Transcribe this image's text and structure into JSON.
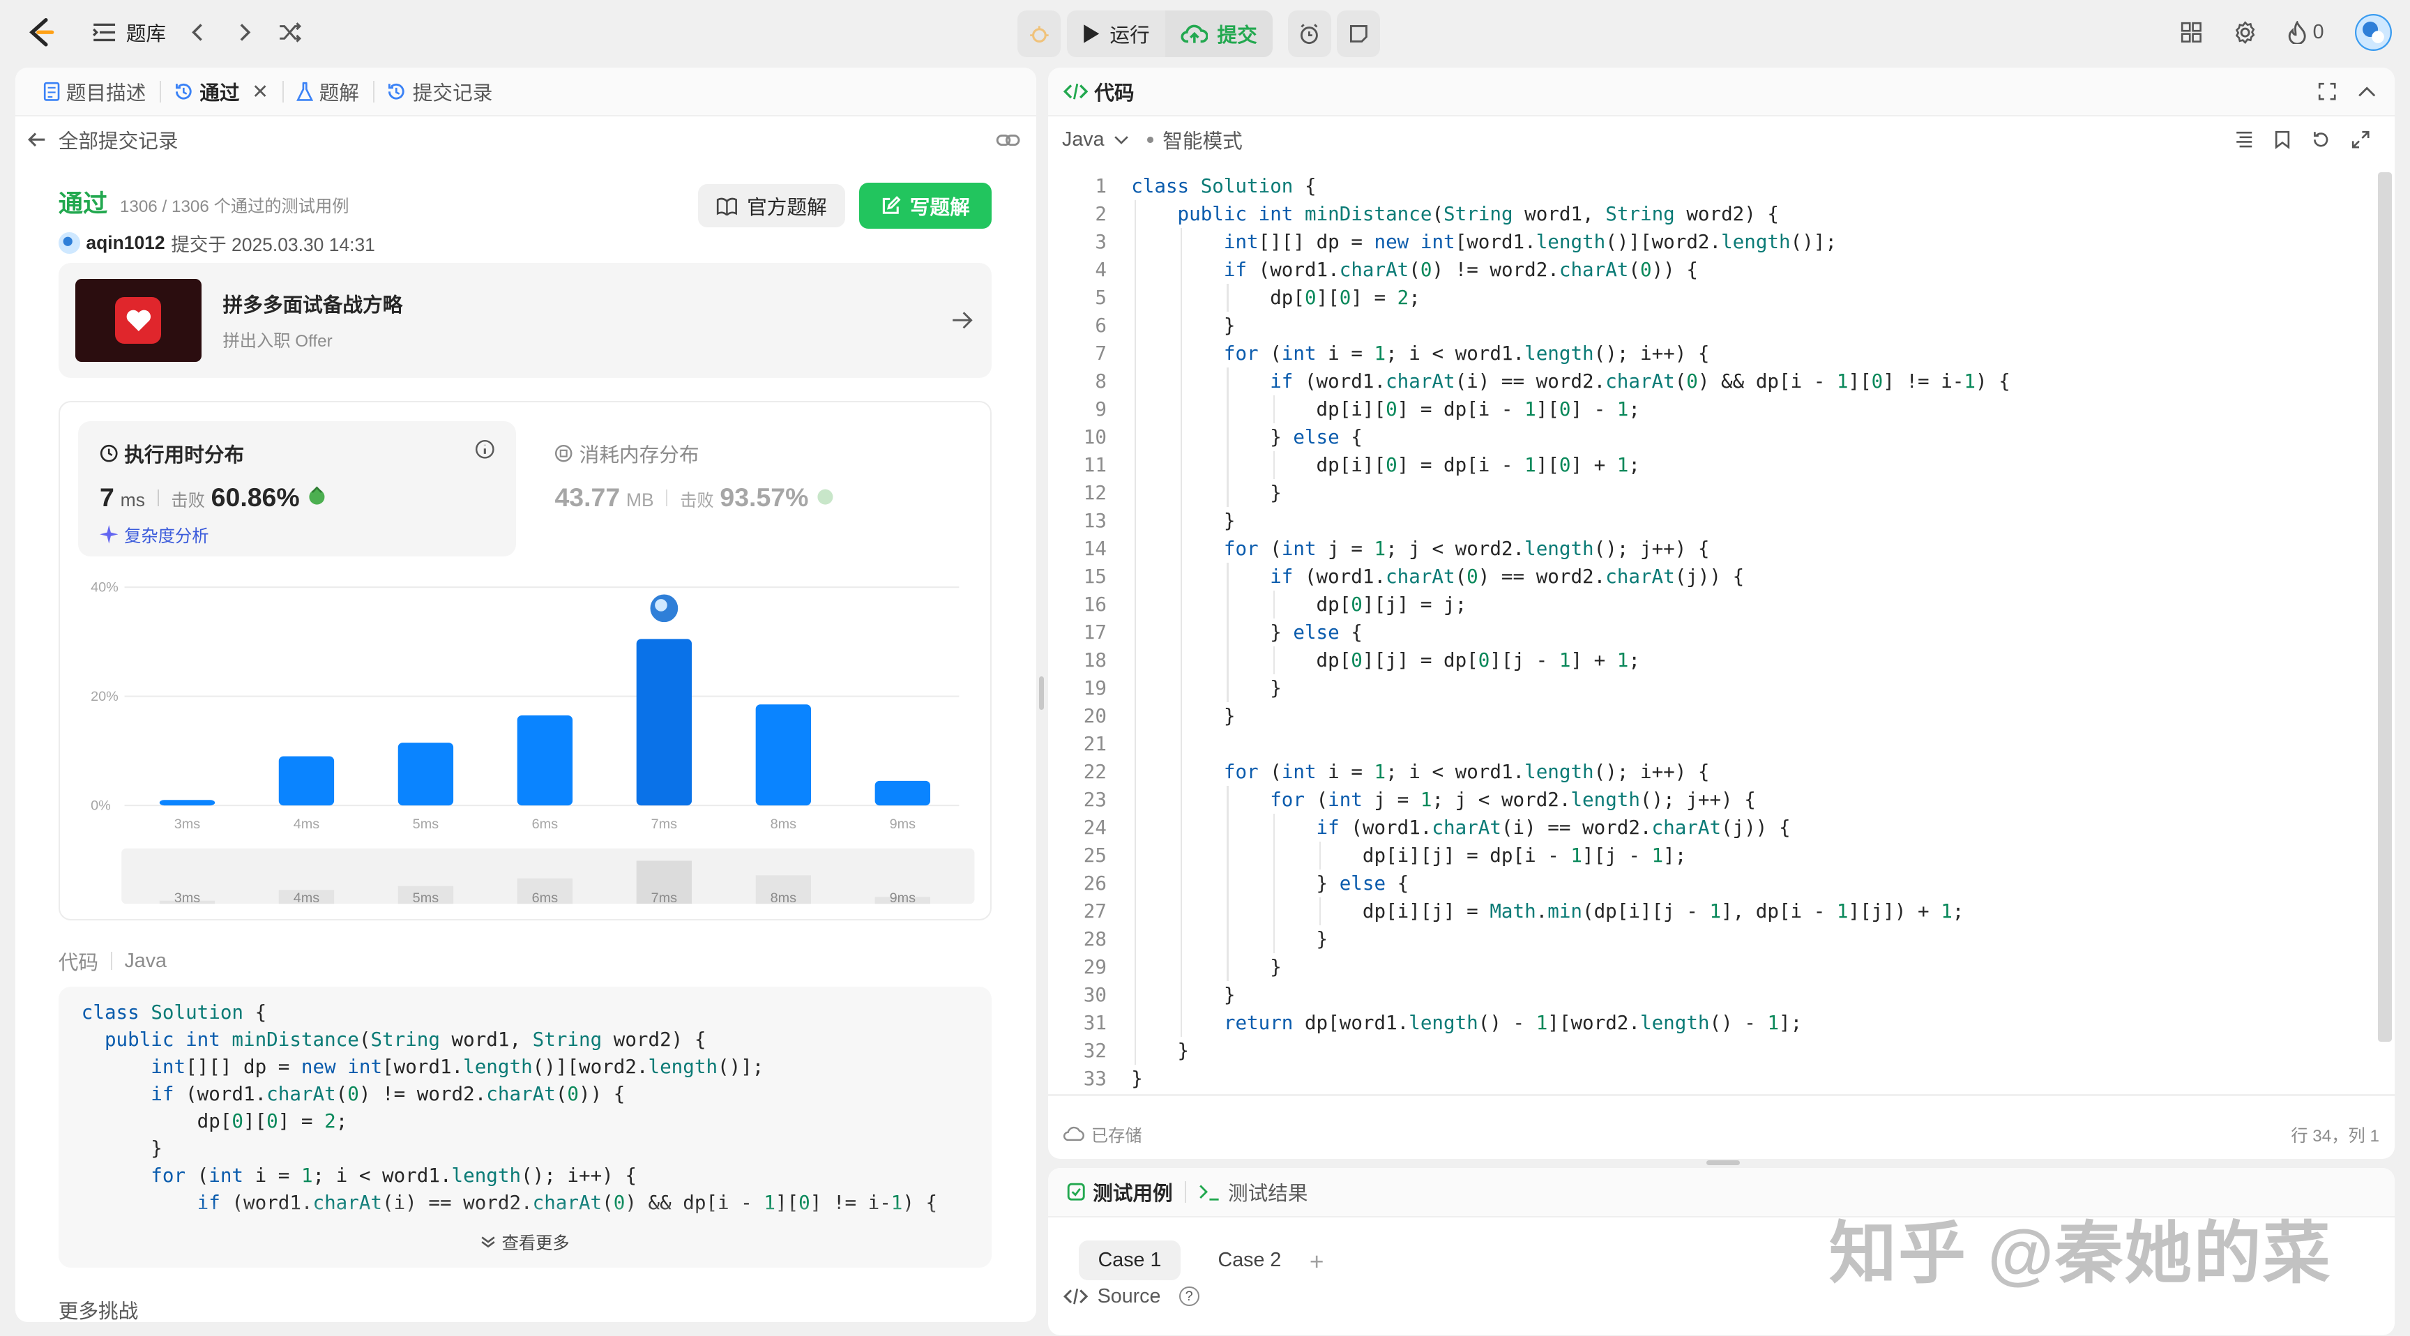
{
  "topbar": {
    "problem_bank": "题库",
    "run": "运行",
    "submit": "提交",
    "streak_count": "0"
  },
  "left": {
    "tabs": [
      "题目描述",
      "通过",
      "题解",
      "提交记录"
    ],
    "back_label": "全部提交记录",
    "status": "通过",
    "testcases": "1306 / 1306 个通过的测试用例",
    "user": "aqin1012",
    "submitted_at": "提交于 2025.03.30 14:31",
    "official_solution": "官方题解",
    "write_solution": "写题解",
    "ad_title": "拼多多面试备战方略",
    "ad_subtitle": "拼出入职 Offer",
    "runtime_title": "执行用时分布",
    "runtime_value": "7",
    "runtime_unit": "ms",
    "beats_label": "击败",
    "runtime_beats": "60.86%",
    "complexity_link": "复杂度分析",
    "memory_title": "消耗内存分布",
    "memory_value": "43.77",
    "memory_unit": "MB",
    "memory_beats": "93.57%",
    "code_label": "代码",
    "code_lang": "Java",
    "view_more": "查看更多",
    "more_challenges": "更多挑战"
  },
  "chart_data": {
    "type": "bar",
    "categories": [
      "3ms",
      "4ms",
      "5ms",
      "6ms",
      "7ms",
      "8ms",
      "9ms"
    ],
    "values": [
      1,
      9,
      11.5,
      16.5,
      30.5,
      18.5,
      4.5
    ],
    "ylim": [
      0,
      40
    ],
    "y_ticks": [
      "0%",
      "20%",
      "40%"
    ],
    "highlight": "7ms",
    "colors": {
      "bar": "#0a84ff",
      "highlight": "#0a72e8"
    }
  },
  "editor": {
    "title": "代码",
    "language": "Java",
    "mode": "智能模式",
    "saved": "已存储",
    "cursor": "行 34，列 1",
    "code": [
      "class Solution {",
      "    public int minDistance(String word1, String word2) {",
      "        int[][] dp = new int[word1.length()][word2.length()];",
      "        if (word1.charAt(0) != word2.charAt(0)) {",
      "            dp[0][0] = 2;",
      "        }",
      "        for (int i = 1; i < word1.length(); i++) {",
      "            if (word1.charAt(i) == word2.charAt(0) && dp[i - 1][0] != i-1) {",
      "                dp[i][0] = dp[i - 1][0] - 1;",
      "            } else {",
      "                dp[i][0] = dp[i - 1][0] + 1;",
      "            }",
      "        }",
      "        for (int j = 1; j < word2.length(); j++) {",
      "            if (word1.charAt(0) == word2.charAt(j)) {",
      "                dp[0][j] = j;",
      "            } else {",
      "                dp[0][j] = dp[0][j - 1] + 1;",
      "            }",
      "        }",
      "",
      "        for (int i = 1; i < word1.length(); i++) {",
      "            for (int j = 1; j < word2.length(); j++) {",
      "                if (word1.charAt(i) == word2.charAt(j)) {",
      "                    dp[i][j] = dp[i - 1][j - 1];",
      "                } else {",
      "                    dp[i][j] = Math.min(dp[i][j - 1], dp[i - 1][j]) + 1;",
      "                }",
      "            }",
      "        }",
      "        return dp[word1.length() - 1][word2.length() - 1];",
      "    }",
      "}"
    ]
  },
  "bottom": {
    "tab_testcase": "测试用例",
    "tab_result": "测试结果",
    "case1": "Case 1",
    "case2": "Case 2",
    "source": "Source"
  },
  "watermark": "知乎 @秦她的菜"
}
